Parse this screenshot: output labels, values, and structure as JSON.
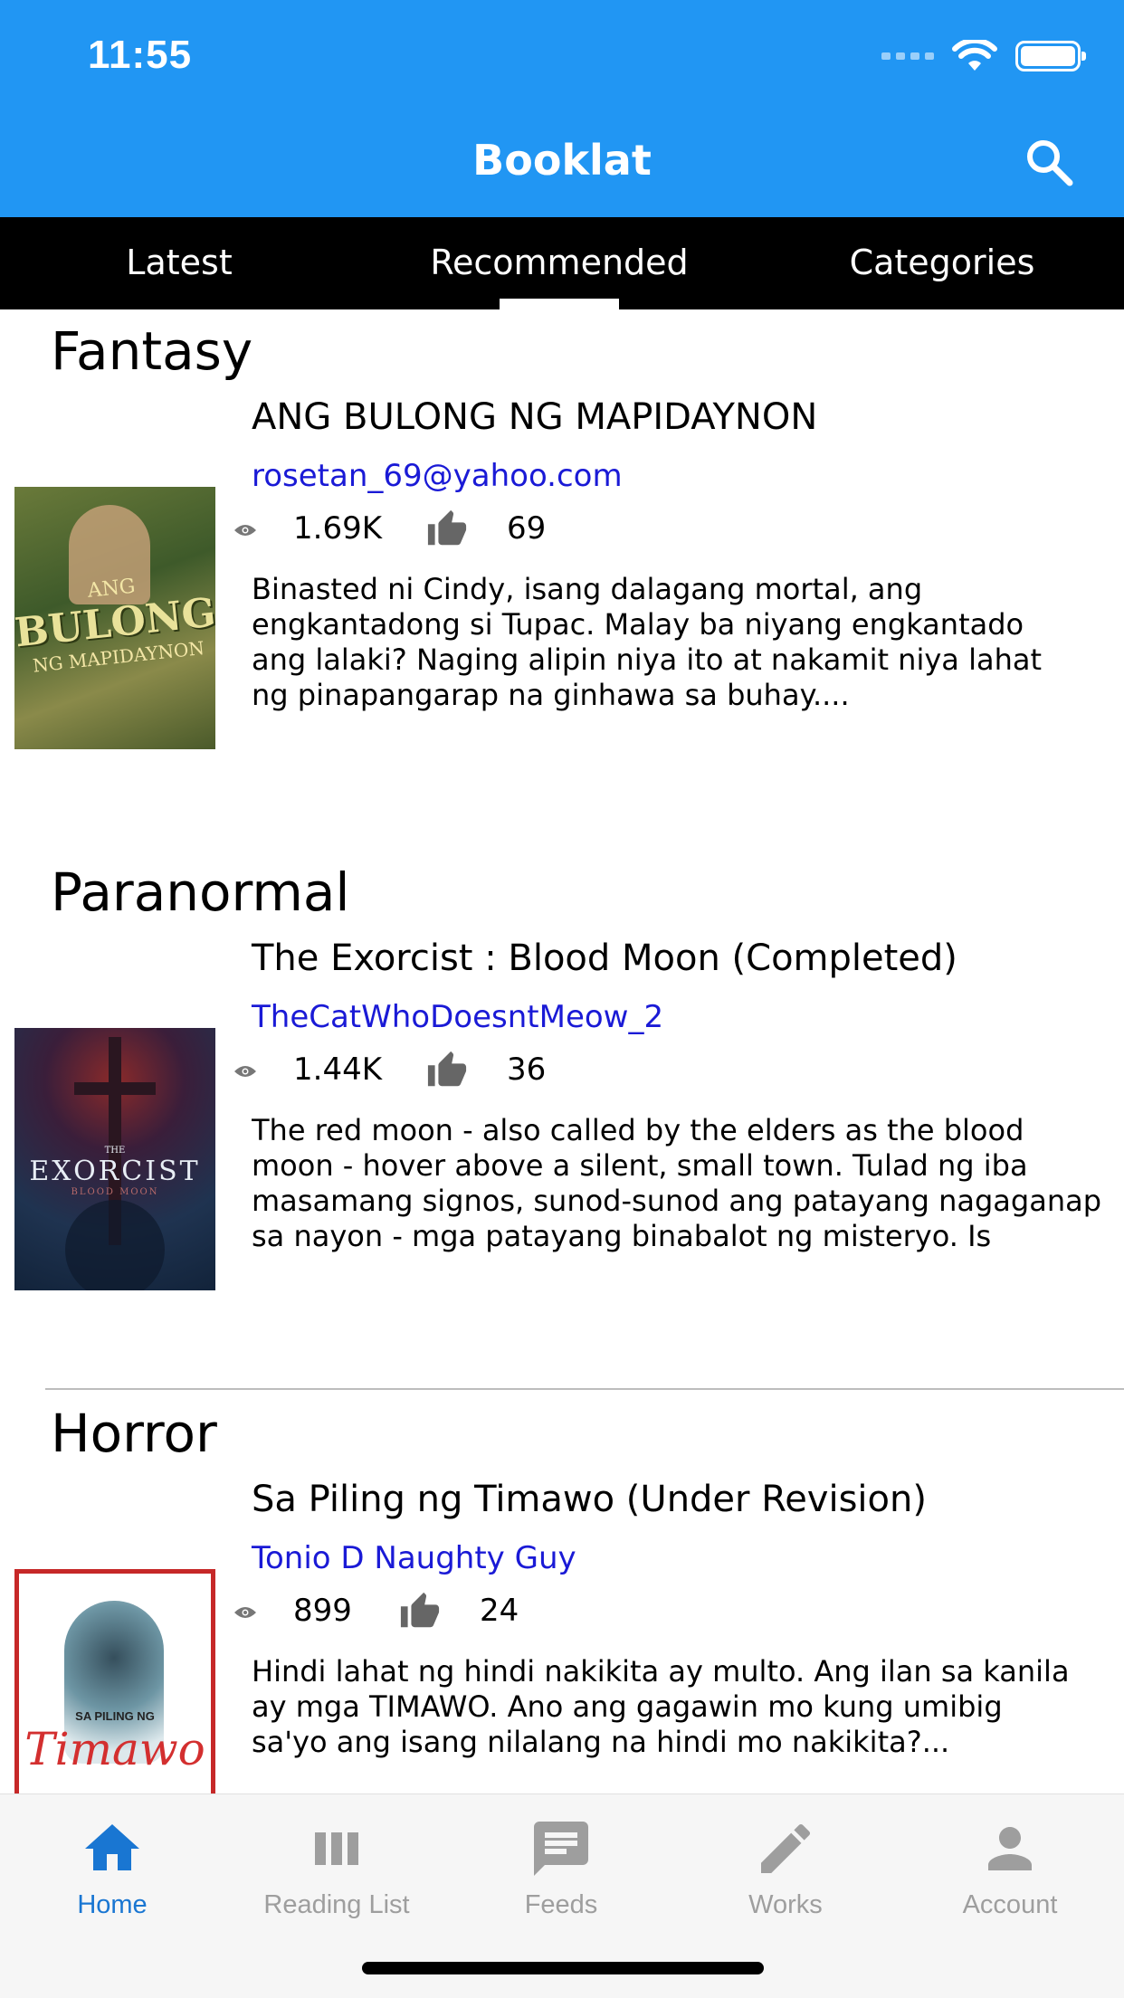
{
  "status": {
    "time": "11:55"
  },
  "header": {
    "title": "Booklat",
    "search_icon": "search-icon"
  },
  "tabs": [
    {
      "label": "Latest"
    },
    {
      "label": "Recommended",
      "active": true
    },
    {
      "label": "Categories"
    }
  ],
  "sections": [
    {
      "category": "Fantasy",
      "title": " ANG BULONG NG MAPIDAYNON",
      "author": "rosetan_69@yahoo.com",
      "views": "1.69K",
      "likes": "69",
      "cover_text": [
        "ANG",
        "BULONG",
        "NG MAPIDAYNON"
      ],
      "description": [
        "Binasted ni Cindy, isang dalagang mortal, ang",
        "engkantadong si Tupac. Malay ba niyang engkantado",
        "ang lalaki? Naging alipin niya ito at nakamit niya lahat",
        "ng pinapangarap na ginhawa sa buhay...."
      ]
    },
    {
      "category": "Paranormal",
      "title": "The Exorcist : Blood Moon (Completed)",
      "author": "TheCatWhoDoesntMeow_2",
      "views": "1.44K",
      "likes": "36",
      "cover_text": [
        "THE",
        "EXORCIST",
        "BLOOD MOON"
      ],
      "description": [
        "The red moon - also called by the elders as the blood",
        "moon - hover above a silent, small town. Tulad ng iba",
        "masamang signos, sunod-sunod ang patayang nagaganap",
        "sa nayon - mga patayang binabalot ng misteryo. Is"
      ]
    },
    {
      "category": "Horror",
      "title": "Sa Piling ng Timawo (Under Revision)",
      "author": "Tonio D Naughty Guy",
      "views": "899",
      "likes": "24",
      "cover_text": [
        "SA PILING NG",
        "Timawo"
      ],
      "description": [
        "Hindi lahat ng hindi nakikita ay multo. Ang ilan sa kanila",
        "ay mga TIMAWO. Ano ang gagawin mo kung umibig",
        "sa'yo ang isang nilalang na hindi mo nakikita?..."
      ]
    }
  ],
  "bottom_nav": [
    {
      "label": "Home",
      "icon": "home-icon",
      "active": true
    },
    {
      "label": "Reading List",
      "icon": "reading-list-icon"
    },
    {
      "label": "Feeds",
      "icon": "feeds-icon"
    },
    {
      "label": "Works",
      "icon": "pencil-icon"
    },
    {
      "label": "Account",
      "icon": "account-icon"
    }
  ],
  "colors": {
    "primary": "#2196F3",
    "tab_bar": "#000000",
    "author": "#1a1ad6",
    "nav_active": "#1976D2",
    "nav_inactive": "#9e9e9e"
  }
}
